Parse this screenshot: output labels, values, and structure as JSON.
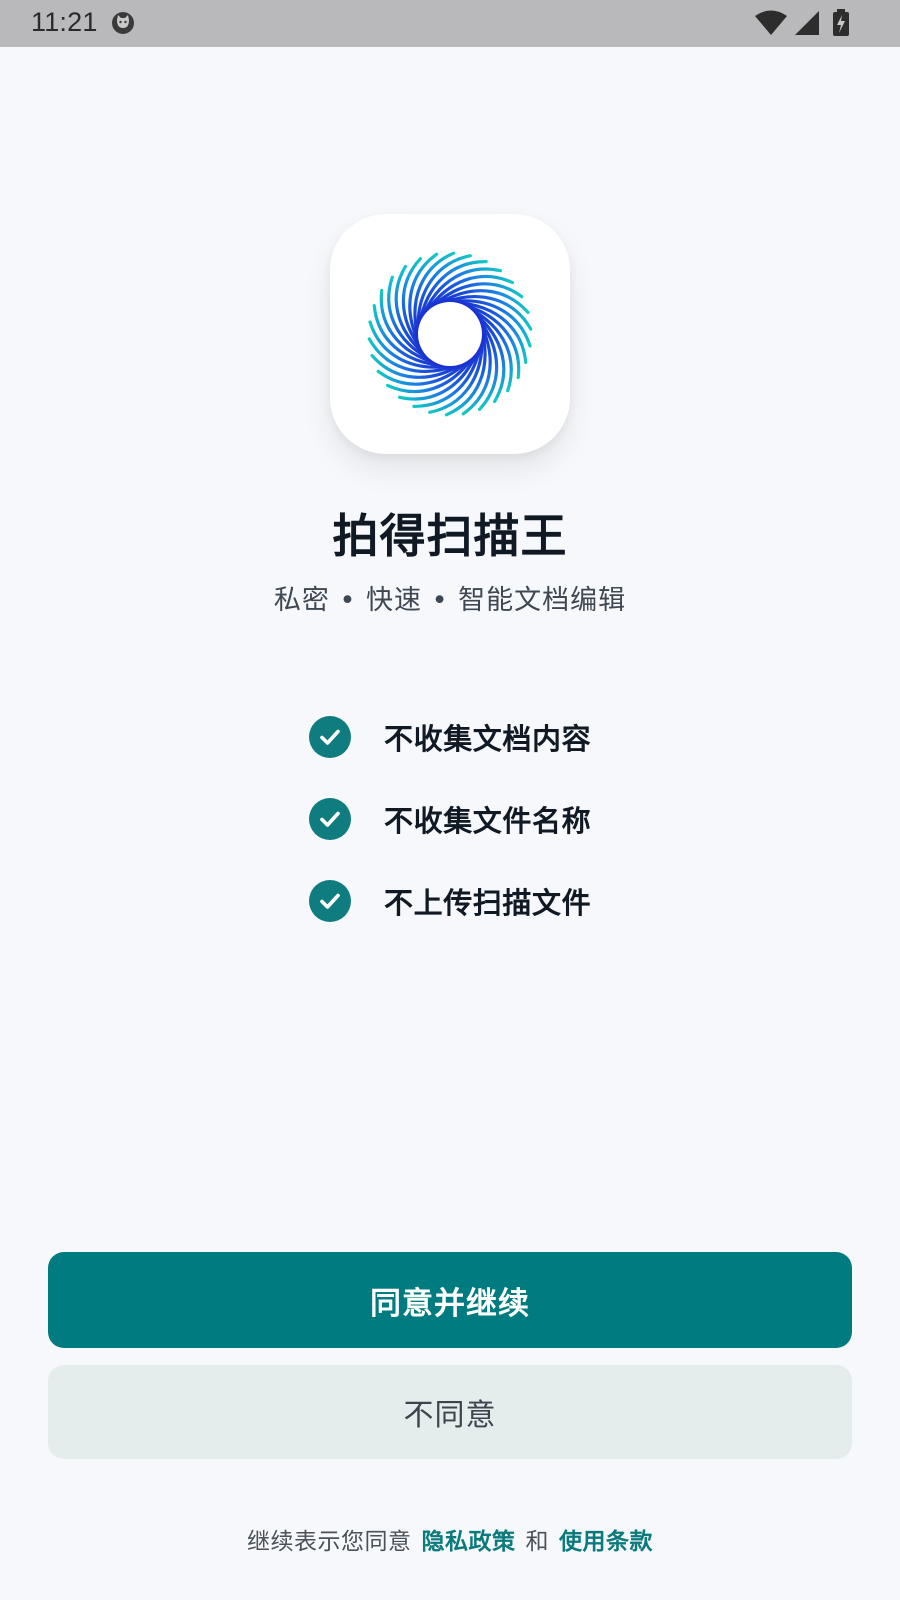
{
  "status_bar": {
    "time": "11:21",
    "icons": [
      "cat-notification-icon",
      "wifi-icon",
      "cellular-signal-icon",
      "battery-charging-icon"
    ]
  },
  "app": {
    "icon": "spiral-logo-icon",
    "name": "拍得扫描王",
    "tagline": "私密 • 快速 • 智能文档编辑"
  },
  "features": [
    {
      "label": "不收集文档内容",
      "icon": "check-circle-icon"
    },
    {
      "label": "不收集文件名称",
      "icon": "check-circle-icon"
    },
    {
      "label": "不上传扫描文件",
      "icon": "check-circle-icon"
    }
  ],
  "buttons": {
    "agree_label": "同意并继续",
    "disagree_label": "不同意"
  },
  "footer": {
    "prefix": "继续表示您同意",
    "privacy_link": "隐私政策",
    "conjunction": "和",
    "terms_link": "使用条款"
  },
  "colors": {
    "accent": "#007b7f",
    "background": "#f6f8fb",
    "secondary_button": "#e5ecec",
    "status_bar": "#b9b9bb"
  }
}
